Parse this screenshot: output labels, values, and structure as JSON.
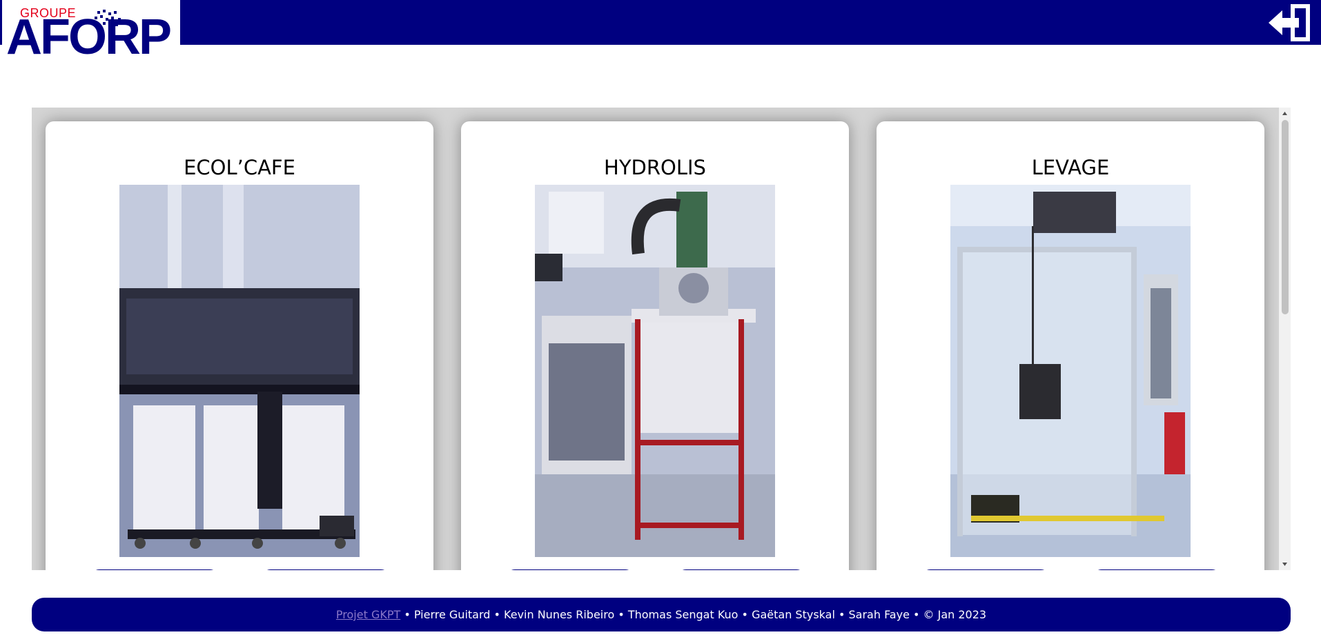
{
  "header": {
    "logo_small": "GROUPE",
    "logo_big": "AFORP",
    "logout_icon": "logout-arrow-icon"
  },
  "cards": [
    {
      "title": "ECOL’CAFE",
      "image": "ecolcafe-machine-photo"
    },
    {
      "title": "HYDROLIS",
      "image": "hydrolis-machine-photo"
    },
    {
      "title": "LEVAGE",
      "image": "levage-machine-photo"
    }
  ],
  "footer": {
    "link": "Projet GKPT",
    "credits": " • Pierre Guitard • Kevin Nunes Ribeiro • Thomas Sengat Kuo • Gaëtan Styskal • Sarah Faye • © Jan 2023"
  },
  "colors": {
    "brand_navy": "#000080",
    "logo_red": "#e4001b",
    "panel_gray": "#d4d4d4"
  }
}
